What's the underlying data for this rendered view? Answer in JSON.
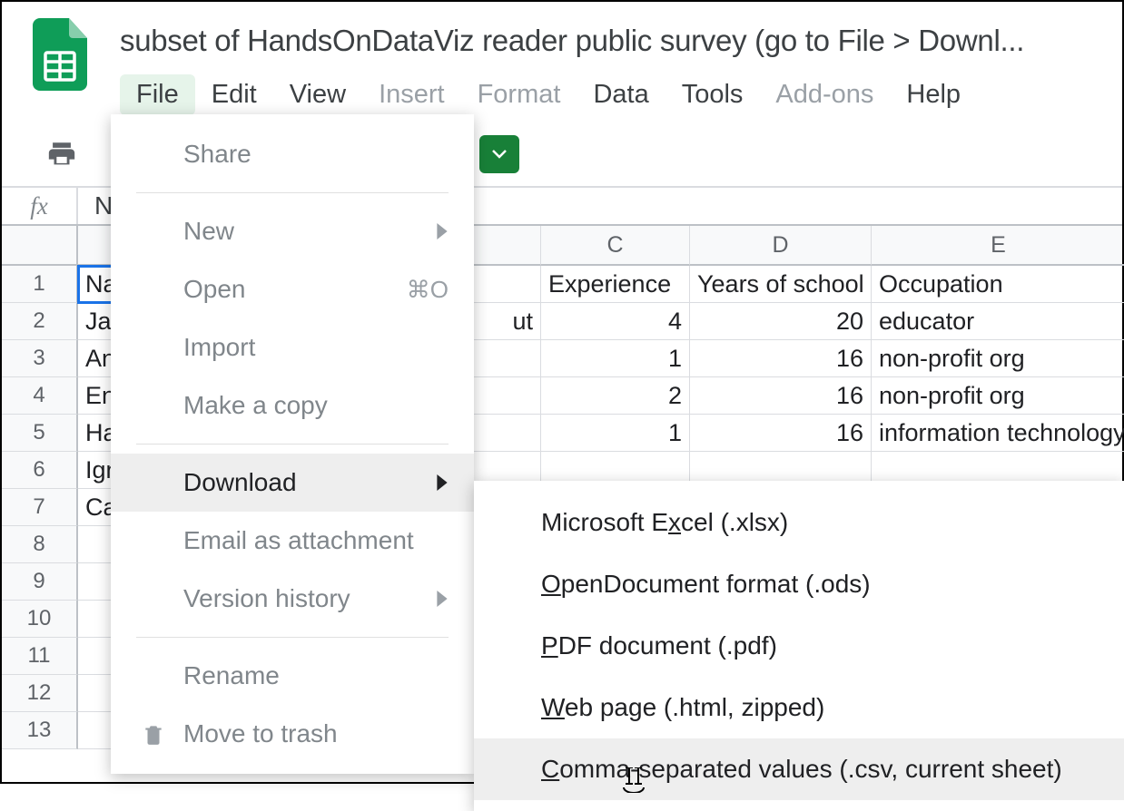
{
  "doc_title": "subset of HandsOnDataViz reader public survey (go to File > Downl...",
  "menubar": {
    "file": "File",
    "edit": "Edit",
    "view": "View",
    "insert": "Insert",
    "format": "Format",
    "data": "Data",
    "tools": "Tools",
    "addons": "Add-ons",
    "help": "Help"
  },
  "fx": {
    "label": "fx",
    "cellref_prefix": "N"
  },
  "columns": {
    "A": "",
    "B": "",
    "C": "C",
    "D": "D",
    "E": "E"
  },
  "row_numbers": [
    "1",
    "2",
    "3",
    "4",
    "5",
    "6",
    "7",
    "8",
    "9",
    "10",
    "11",
    "12",
    "13"
  ],
  "headers": {
    "A": "Na",
    "B": "",
    "C": "Experience",
    "D": "Years of school",
    "E": "Occupation"
  },
  "rows": [
    {
      "A": "Ja",
      "B": "ut",
      "C": "4",
      "D": "20",
      "E": "educator"
    },
    {
      "A": "An",
      "B": "",
      "C": "1",
      "D": "16",
      "E": "non-profit org"
    },
    {
      "A": "En",
      "B": "",
      "C": "2",
      "D": "16",
      "E": "non-profit org"
    },
    {
      "A": "Ha",
      "B": "",
      "C": "1",
      "D": "16",
      "E": "information technology"
    },
    {
      "A": "Ign",
      "B": "",
      "C": "",
      "D": "",
      "E": ""
    },
    {
      "A": "Ca",
      "B": "",
      "C": "",
      "D": "",
      "E": ""
    }
  ],
  "file_menu": {
    "share": "Share",
    "new": "New",
    "open": "Open",
    "open_shortcut": "⌘O",
    "import": "Import",
    "make_copy": "Make a copy",
    "download": "Download",
    "email_attachment": "Email as attachment",
    "version_history": "Version history",
    "rename": "Rename",
    "move_trash": "Move to trash"
  },
  "download_submenu": {
    "xlsx_pre": "Microsoft E",
    "xlsx_u": "x",
    "xlsx_post": "cel (.xlsx)",
    "ods_u": "O",
    "ods_post": "penDocument format (.ods)",
    "pdf_u": "P",
    "pdf_post": "DF document (.pdf)",
    "web_u": "W",
    "web_post": "eb page (.html, zipped)",
    "csv_u": "C",
    "csv_post": "omma-separated values (.csv, current sheet)"
  }
}
